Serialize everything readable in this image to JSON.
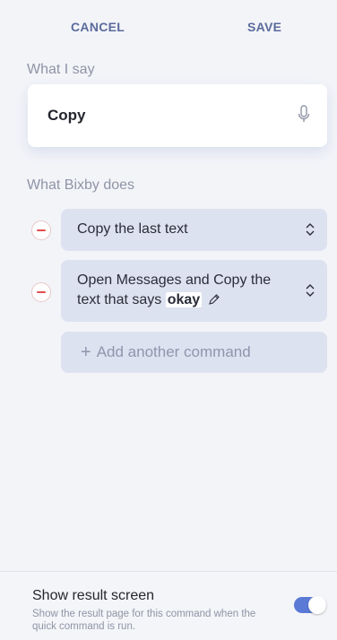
{
  "header": {
    "cancel_label": "CANCEL",
    "save_label": "SAVE"
  },
  "what_i_say": {
    "label": "What I say",
    "phrase": "Copy",
    "icon": "microphone-icon"
  },
  "what_bixby_does": {
    "label": "What Bixby does",
    "commands": [
      {
        "text": "Copy the last text"
      },
      {
        "text_prefix": "Open Messages and Copy the text that says ",
        "keyword": "okay"
      }
    ],
    "add_label": "Add another command"
  },
  "result_screen": {
    "title": "Show result screen",
    "description": "Show the result page for this command when the quick command is run.",
    "enabled": true
  },
  "colors": {
    "accent": "#5b7ad6",
    "remove": "#e34d4d",
    "command_bg": "#dde2f0"
  }
}
